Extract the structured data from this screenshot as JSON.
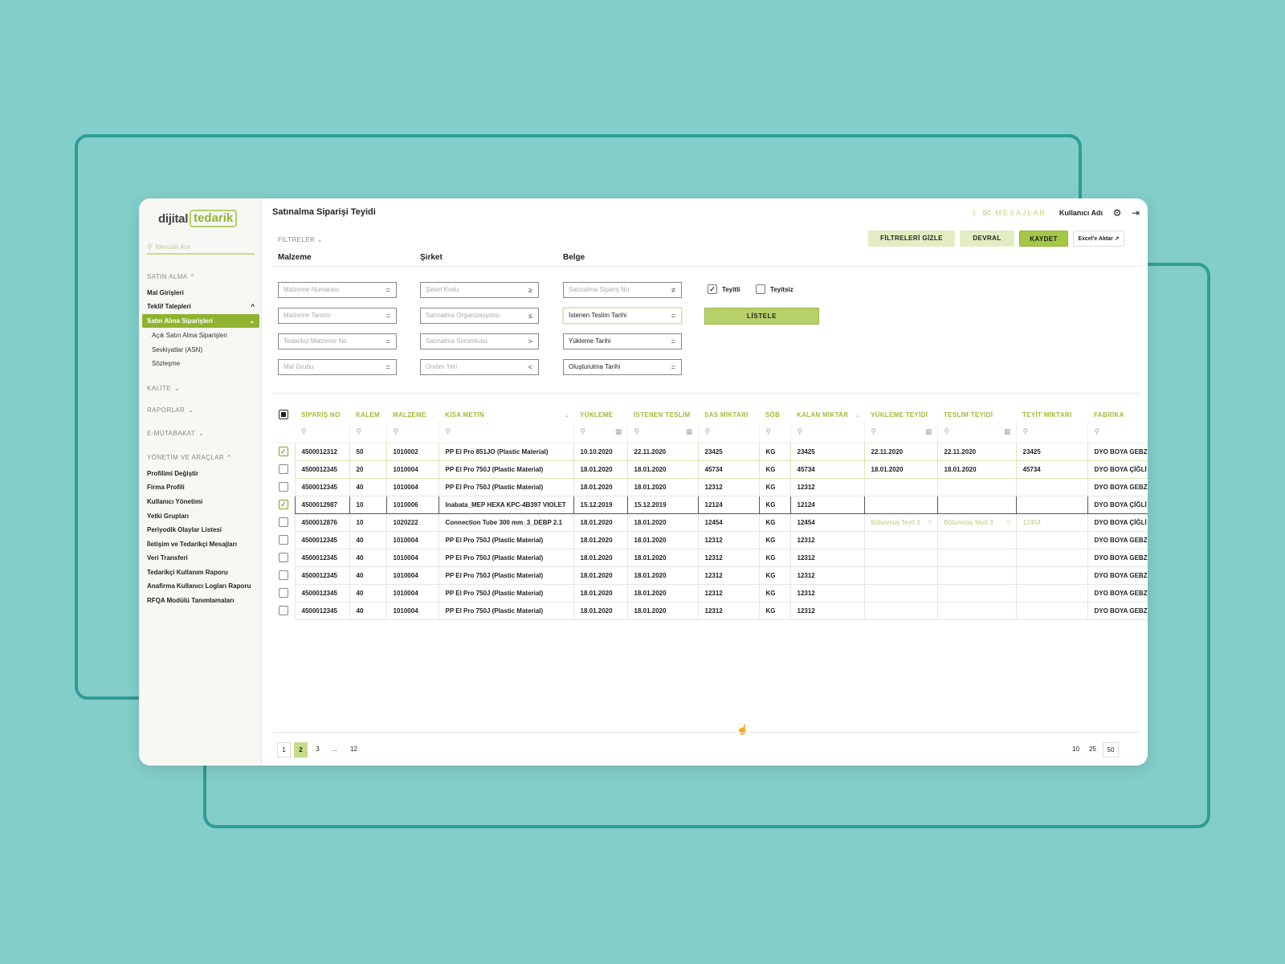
{
  "app": {
    "logo_prefix": "dijital",
    "logo_brand": "tedarik",
    "page_title": "Satınalma Siparişi Teyidi"
  },
  "header": {
    "message_count": "1",
    "messages_label": "MESAJLAR",
    "user_name": "Kullanıcı Adı"
  },
  "sidebar": {
    "search_placeholder": "Menüde Ara",
    "sections": {
      "satin_alma": "SATIN ALMA",
      "kalite": "KALİTE",
      "raporlar": "RAPORLAR",
      "e_mutabakat": "E-MÜTABAKAT",
      "yonetim": "YÖNETİM VE ARAÇLAR"
    },
    "satin_alma_items": [
      "Mal Girişleri",
      "Teklif Talepleri",
      "Satın Alma Siparişleri"
    ],
    "sub_items": [
      "Açık Satın Alma Siparişleri",
      "Sevkiyatlar (ASN)",
      "Sözleşme"
    ],
    "yonetim_items": [
      "Profilimi Değiştir",
      "Firma Profili",
      "Kullanıcı Yönetimi",
      "Yetki Grupları",
      "Periyodik Olaylar Listesi",
      "İletişim ve Tedarikçi Mesajları",
      "Veri Transferi",
      "Tedarikçi Kullanım Raporu",
      "Anafirma Kullanıcı Logları Raporu",
      "RFQA Modülü Tanımlamaları"
    ]
  },
  "toolbar": {
    "filters_label": "FİLTRELER",
    "hide_filters": "FİLTRELERİ GİZLE",
    "devral": "DEVRAL",
    "kaydet": "KAYDET",
    "excel": "Excel'e Aktar"
  },
  "filters": {
    "groups": [
      "Malzeme",
      "Şirket",
      "Belge"
    ],
    "malzeme": [
      {
        "text": "Malzeme Numarası",
        "op": "="
      },
      {
        "text": "Malzeme Tanımı",
        "op": "="
      },
      {
        "text": "Tedarikçi Malzeme No",
        "op": "="
      },
      {
        "text": "Mal Grubu",
        "op": "="
      }
    ],
    "sirket": [
      {
        "text": "Şirket Kodu",
        "op": "≥"
      },
      {
        "text": "Satınalma Organizasyonu",
        "op": "≤"
      },
      {
        "text": "Satınalma Sorumlusu",
        "op": ">"
      },
      {
        "text": "Üretim Yeri",
        "op": "<"
      }
    ],
    "belge": [
      {
        "text": "Satınalma Sipariş No",
        "op": "≠"
      },
      {
        "text": "İstenen Teslim Tarihi",
        "op": "="
      },
      {
        "text": "Yükleme Tarihi",
        "op": "="
      },
      {
        "text": "Oluşturulma Tarihi",
        "op": "="
      }
    ],
    "teyitli": "Teyitli",
    "teyitsiz": "Teyitsiz",
    "listele": "LİSTELE"
  },
  "table": {
    "columns": [
      "SİPARİŞ NO",
      "KALEM",
      "MALZEME",
      "KISA METİN",
      "YÜKLEME",
      "İSTENEN TESLİM",
      "SAS MİKTARI",
      "SÖB",
      "KALAN MİKTAR",
      "YÜKLEME TEYİDİ",
      "TESLİM TEYİDİ",
      "TEYİT MİKTARI",
      "FABRİKA"
    ],
    "sort_arrow": "↓",
    "rows": [
      [
        "4500012312",
        "50",
        "1010002",
        "PP El Pro 851JO (Plastic Material)",
        "10.10.2020",
        "22.11.2020",
        "23425",
        "KG",
        "23425",
        "22.11.2020",
        "22.11.2020",
        "23425",
        "DYO BOYA GEBZE"
      ],
      [
        "4500012345",
        "20",
        "1010004",
        "PP El Pro 750J (Plastic Material)",
        "18.01.2020",
        "18.01.2020",
        "45734",
        "KG",
        "45734",
        "18.01.2020",
        "18.01.2020",
        "45734",
        "DYO BOYA ÇİĞLİ İZMİR"
      ],
      [
        "4500012345",
        "40",
        "1010004",
        "PP El Pro 750J (Plastic Material)",
        "18.01.2020",
        "18.01.2020",
        "12312",
        "KG",
        "12312",
        "",
        "",
        "",
        "DYO BOYA GEBZE"
      ],
      [
        "4500012987",
        "10",
        "1010006",
        "Inabata_MEP HEXA KPC-4B397 VIOLET",
        "15.12.2019",
        "15.12.2019",
        "12124",
        "KG",
        "12124",
        "",
        "",
        "",
        "DYO BOYA ÇİĞLİ İZMİR"
      ],
      [
        "4500012876",
        "10",
        "1020222",
        "Connection Tube 300 mm_3_DEBP 2.1",
        "18.01.2020",
        "18.01.2020",
        "12454",
        "KG",
        "12454",
        "Bölünmüş Teyit   3",
        "Bölünmüş Teyit     3",
        "12454",
        "DYO BOYA ÇİĞLİ İZMİR"
      ],
      [
        "4500012345",
        "40",
        "1010004",
        "PP El Pro 750J (Plastic Material)",
        "18.01.2020",
        "18.01.2020",
        "12312",
        "KG",
        "12312",
        "",
        "",
        "",
        "DYO BOYA GEBZE"
      ],
      [
        "4500012345",
        "40",
        "1010004",
        "PP El Pro 750J (Plastic Material)",
        "18.01.2020",
        "18.01.2020",
        "12312",
        "KG",
        "12312",
        "",
        "",
        "",
        "DYO BOYA GEBZE"
      ],
      [
        "4500012345",
        "40",
        "1010004",
        "PP El Pro 750J (Plastic Material)",
        "18.01.2020",
        "18.01.2020",
        "12312",
        "KG",
        "12312",
        "",
        "",
        "",
        "DYO BOYA GEBZE"
      ],
      [
        "4500012345",
        "40",
        "1010004",
        "PP El Pro 750J (Plastic Material)",
        "18.01.2020",
        "18.01.2020",
        "12312",
        "KG",
        "12312",
        "",
        "",
        "",
        "DYO BOYA GEBZE"
      ],
      [
        "4500012345",
        "40",
        "1010004",
        "PP El Pro 750J (Plastic Material)",
        "18.01.2020",
        "18.01.2020",
        "12312",
        "KG",
        "12312",
        "",
        "",
        "",
        "DYO BOYA GEBZE"
      ]
    ],
    "row_checked": [
      true,
      false,
      false,
      true,
      false,
      false,
      false,
      false,
      false,
      false
    ],
    "row_style": [
      "confirmed",
      "confirmed",
      "",
      "selected",
      "split",
      "",
      "",
      "",
      "",
      ""
    ]
  },
  "pagination": {
    "pages": [
      "1",
      "2",
      "3",
      "...",
      "12"
    ],
    "current": "2",
    "page_sizes": [
      "10",
      "25",
      "50"
    ],
    "current_size": "50"
  },
  "colors": {
    "accent": "#8fb32f",
    "accent_light": "#e2edc2",
    "background": "#83cec9",
    "frame": "#2f9d95"
  }
}
